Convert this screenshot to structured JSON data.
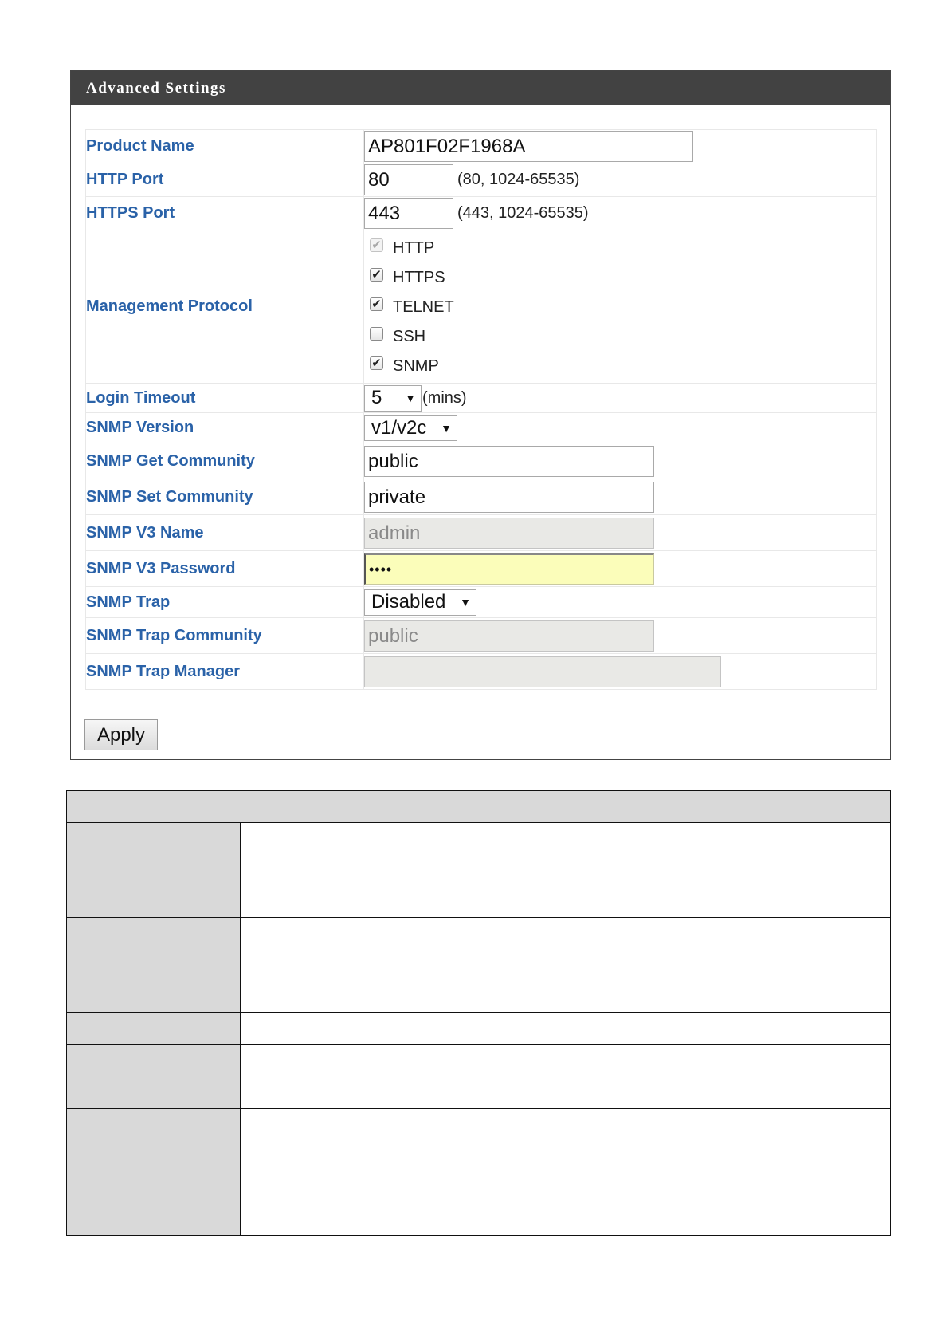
{
  "panel": {
    "title": "Advanced Settings",
    "rows": {
      "product_name": {
        "label": "Product Name",
        "value": "AP801F02F1968A"
      },
      "http_port": {
        "label": "HTTP Port",
        "value": "80",
        "hint": "(80, 1024-65535)"
      },
      "https_port": {
        "label": "HTTPS Port",
        "value": "443",
        "hint": "(443, 1024-65535)"
      },
      "management_protocol": {
        "label": "Management Protocol",
        "options": [
          {
            "label": "HTTP",
            "checked": true,
            "disabled": true
          },
          {
            "label": "HTTPS",
            "checked": true,
            "disabled": false
          },
          {
            "label": "TELNET",
            "checked": true,
            "disabled": false
          },
          {
            "label": "SSH",
            "checked": false,
            "disabled": false
          },
          {
            "label": "SNMP",
            "checked": true,
            "disabled": false
          }
        ]
      },
      "login_timeout": {
        "label": "Login Timeout",
        "value": "5",
        "unit": "(mins)"
      },
      "snmp_version": {
        "label": "SNMP Version",
        "value": "v1/v2c"
      },
      "snmp_get_community": {
        "label": "SNMP Get Community",
        "value": "public"
      },
      "snmp_set_community": {
        "label": "SNMP Set Community",
        "value": "private"
      },
      "snmp_v3_name": {
        "label": "SNMP V3 Name",
        "value": "admin"
      },
      "snmp_v3_password": {
        "label": "SNMP V3 Password",
        "value": "••••"
      },
      "snmp_trap": {
        "label": "SNMP Trap",
        "value": "Disabled"
      },
      "snmp_trap_community": {
        "label": "SNMP Trap Community",
        "value": "public"
      },
      "snmp_trap_manager": {
        "label": "SNMP Trap Manager",
        "value": ""
      }
    },
    "apply_label": "Apply"
  },
  "icons": {
    "checkbox_mark": "check-icon",
    "select_arrow": "triangle-down-icon"
  },
  "colors": {
    "header_bg": "#424242",
    "label_text": "#2a62a8",
    "password_bg": "#fbfdba",
    "table_shade": "#d9d9d9"
  }
}
